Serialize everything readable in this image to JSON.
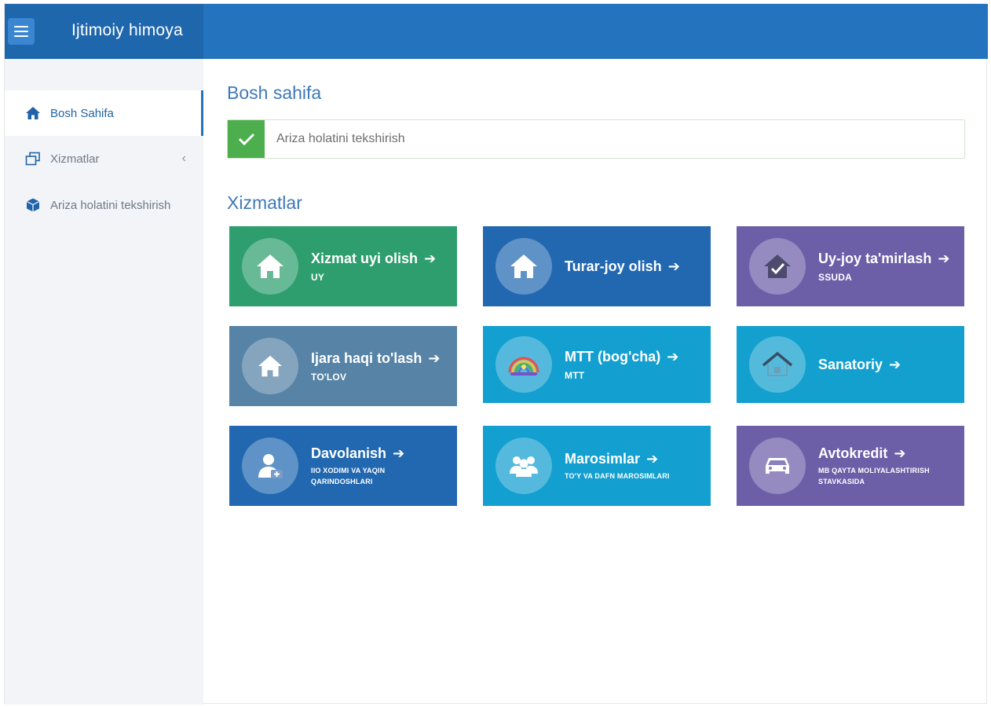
{
  "colors": {
    "topbar": "#2473bf",
    "brand_bg": "#1f67ad",
    "sidebar_bg": "#f2f4f7",
    "title_blue": "#3d79b8",
    "success": "#4cae4c"
  },
  "header": {
    "app_title": "Ijtimoiy himoya",
    "menu_icon": "hamburger-icon"
  },
  "sidebar": {
    "items": [
      {
        "label": "Bosh Sahifa",
        "icon": "home-icon",
        "active": true
      },
      {
        "label": "Xizmatlar",
        "icon": "windows-icon",
        "active": false,
        "chevron": "‹"
      },
      {
        "label": "Ariza holatini tekshirish",
        "icon": "cube-icon",
        "active": false
      }
    ]
  },
  "main": {
    "page_title": "Bosh sahifa",
    "status_text": "Ariza holatini tekshirish",
    "section_title": "Xizmatlar",
    "arrow": "➔",
    "tiles": [
      {
        "title": "Xizmat uyi olish",
        "subtitle": "UY",
        "icon": "home-icon",
        "color": "#2e9e6e"
      },
      {
        "title": "Turar-joy olish",
        "subtitle": "",
        "icon": "home-icon",
        "color": "#2268b0"
      },
      {
        "title": "Uy-joy ta'mirlash",
        "subtitle": "SSUDA",
        "icon": "house-repair-icon",
        "color": "#6c5fa8"
      },
      {
        "title": "Ijara haqi to'lash",
        "subtitle": "TO'LOV",
        "icon": "home-icon",
        "color": "#5683a6"
      },
      {
        "title": "MTT (bog'cha)",
        "subtitle": "MTT",
        "icon": "rainbow-icon",
        "color": "#139fcf"
      },
      {
        "title": "Sanatoriy",
        "subtitle": "",
        "icon": "sanatorium-icon",
        "color": "#13a0cf"
      },
      {
        "title": "Davolanish",
        "subtitle": "IIO XODIMI VA YAQIN QARINDOSHLARI",
        "icon": "patient-icon",
        "color": "#2268b0"
      },
      {
        "title": "Marosimlar",
        "subtitle": "TO'Y VA DAFN MAROSIMLARI",
        "icon": "people-icon",
        "color": "#139fcf"
      },
      {
        "title": "Avtokredit",
        "subtitle": "MB QAYTA MOLIYALASHTIRISH STAVKASIDA",
        "icon": "car-icon",
        "color": "#6c5fa8"
      }
    ]
  }
}
